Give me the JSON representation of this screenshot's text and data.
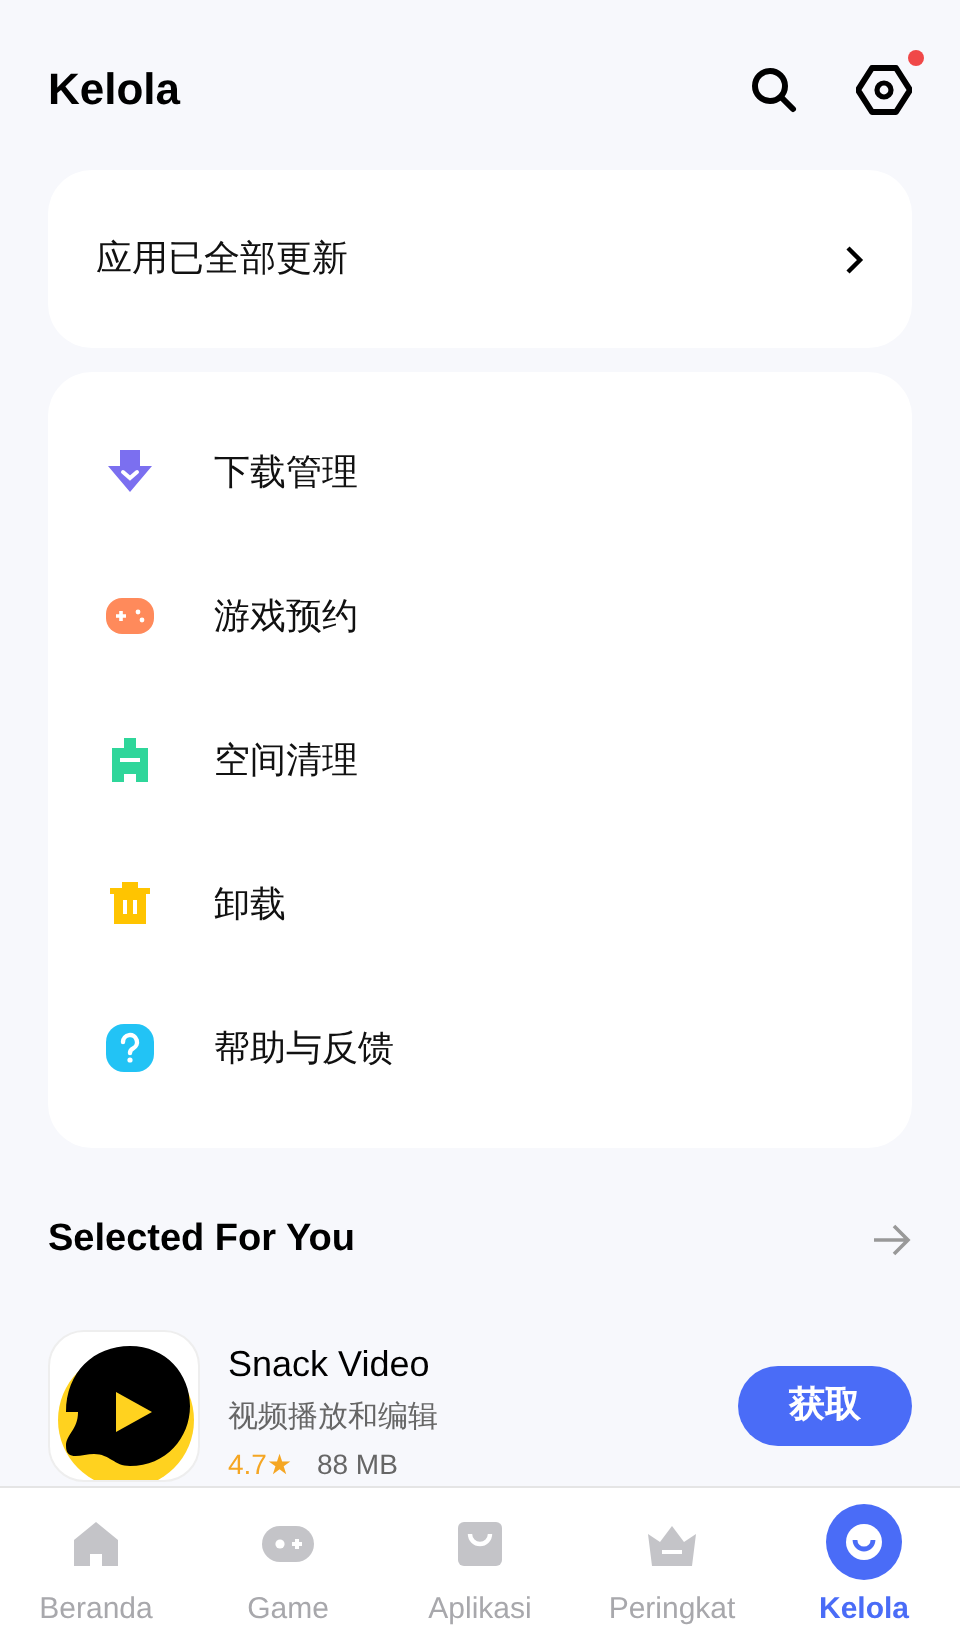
{
  "header": {
    "title": "Kelola",
    "settings_badge": true
  },
  "update_card": {
    "label": "应用已全部更新"
  },
  "menu": [
    {
      "kind": "download",
      "label": "下载管理",
      "color": "#7b6ff0"
    },
    {
      "kind": "game",
      "label": "游戏预约",
      "color": "#ff8a5b"
    },
    {
      "kind": "clean",
      "label": "空间清理",
      "color": "#2fd69a"
    },
    {
      "kind": "uninstall",
      "label": "卸载",
      "color": "#ffc400"
    },
    {
      "kind": "help",
      "label": "帮助与反馈",
      "color": "#22c3f5"
    }
  ],
  "section": {
    "title": "Selected For You"
  },
  "apps": [
    {
      "name": "Snack Video",
      "category": "视频播放和编辑",
      "rating": "4.7★",
      "size": "88 MB",
      "button": "获取"
    }
  ],
  "nav": [
    {
      "kind": "home",
      "label": "Beranda",
      "selected": false
    },
    {
      "kind": "game",
      "label": "Game",
      "selected": false
    },
    {
      "kind": "apps",
      "label": "Aplikasi",
      "selected": false
    },
    {
      "kind": "rank",
      "label": "Peringkat",
      "selected": false
    },
    {
      "kind": "manage",
      "label": "Kelola",
      "selected": true
    }
  ]
}
